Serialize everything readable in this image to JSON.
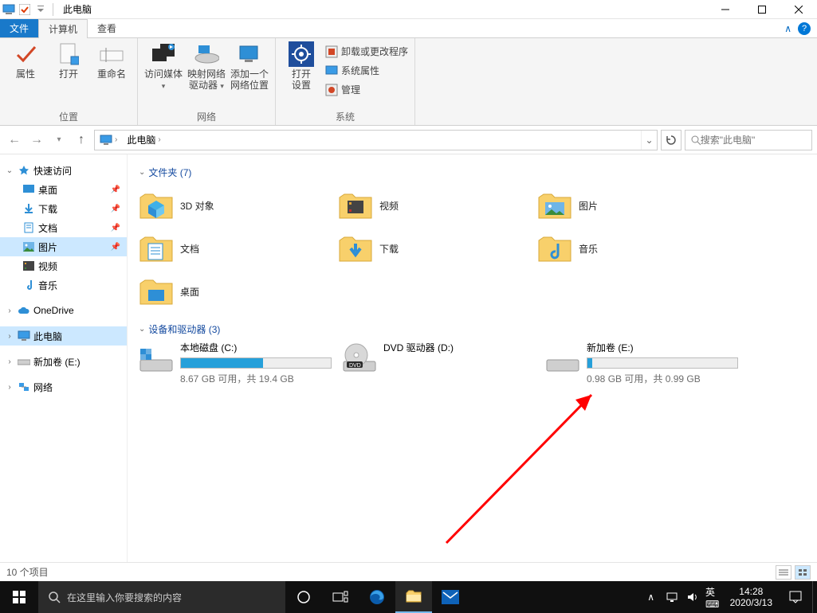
{
  "window": {
    "title": "此电脑"
  },
  "tabs": {
    "file": "文件",
    "computer": "计算机",
    "view": "查看"
  },
  "ribbon": {
    "group_location": "位置",
    "group_network": "网络",
    "group_system": "系统",
    "properties": "属性",
    "open": "打开",
    "rename": "重命名",
    "access_media": "访问媒体",
    "map_drive": "映射网络\n驱动器",
    "add_netloc": "添加一个\n网络位置",
    "open_settings": "打开\n设置",
    "uninstall": "卸载或更改程序",
    "sys_props": "系统属性",
    "manage": "管理"
  },
  "address": {
    "crumb": "此电脑"
  },
  "search": {
    "placeholder": "搜索\"此电脑\""
  },
  "nav": {
    "quick_access": "快速访问",
    "desktop": "桌面",
    "downloads": "下载",
    "documents": "文档",
    "pictures": "图片",
    "videos": "视频",
    "music": "音乐",
    "onedrive": "OneDrive",
    "this_pc": "此电脑",
    "new_volume": "新加卷 (E:)",
    "network": "网络"
  },
  "groups": {
    "folders": "文件夹 (7)",
    "drives": "设备和驱动器 (3)"
  },
  "folders": {
    "objects3d": "3D 对象",
    "videos": "视频",
    "pictures": "图片",
    "documents": "文档",
    "downloads": "下载",
    "music": "音乐",
    "desktop": "桌面"
  },
  "drives": {
    "c": {
      "name": "本地磁盘 (C:)",
      "free": "8.67 GB 可用，共 19.4 GB",
      "fill_pct": 55
    },
    "dvd": {
      "name": "DVD 驱动器 (D:)"
    },
    "e": {
      "name": "新加卷 (E:)",
      "free": "0.98 GB 可用，共 0.99 GB",
      "fill_pct": 3
    }
  },
  "status": {
    "count": "10 个项目"
  },
  "taskbar": {
    "search_placeholder": "在这里输入你要搜索的内容",
    "ime": "英  ⌨",
    "time": "14:28",
    "date": "2020/3/13"
  }
}
